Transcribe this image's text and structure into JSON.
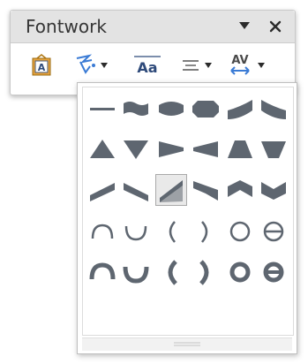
{
  "window": {
    "title": "Fontwork"
  },
  "tools": [
    {
      "id": "fontwork-gallery",
      "icon": "fontwork-gallery-icon"
    },
    {
      "id": "fontwork-shape",
      "icon": "fontwork-shape-icon",
      "has_dropdown": true
    },
    {
      "id": "fontwork-same-letter-heights",
      "icon": "same-letter-heights-icon",
      "label": "Aa"
    },
    {
      "id": "fontwork-alignment",
      "icon": "alignment-icon",
      "has_dropdown": true
    },
    {
      "id": "fontwork-character-spacing",
      "icon": "character-spacing-icon",
      "label": "AV",
      "has_dropdown": true
    }
  ],
  "shape_palette": {
    "rows": [
      [
        "plain-text",
        "wave",
        "inflate",
        "stop",
        "curve-down",
        "curve-up"
      ],
      [
        "triangle-up",
        "triangle-down",
        "fade-right",
        "fade-left",
        "fade-up",
        "fade-down"
      ],
      [
        "slant-up",
        "slant-down",
        "fade-up-and-right",
        "fade-up-and-left",
        "chevron-up",
        "chevron-down"
      ],
      [
        "arch-up-curve",
        "arch-down-curve",
        "arch-left-curve",
        "arch-right-curve",
        "circle-curve",
        "open-circle-curve"
      ],
      [
        "arch-up-pour",
        "arch-down-pour",
        "arch-left-pour",
        "arch-right-pour",
        "circle-pour",
        "open-circle-pour"
      ]
    ],
    "selected": "fade-up-and-right"
  },
  "colors": {
    "shape": "#5e6670",
    "selected_bg": "#e9e9e9",
    "accent_orange": "#d9911b",
    "accent_blue": "#3a7bd5"
  }
}
